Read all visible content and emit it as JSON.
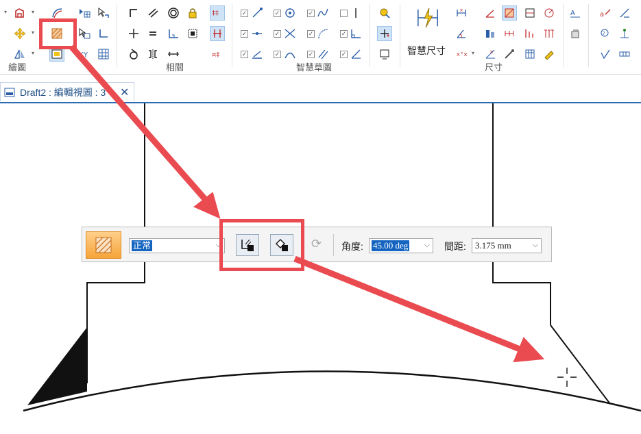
{
  "ribbon": {
    "groups": {
      "draw": "繪圖",
      "relate": "相關",
      "smart_sketch": "智慧草圖",
      "dimension": "尺寸"
    },
    "smart_dimension_label": "智慧尺寸",
    "icons": [
      "polygon-icon",
      "move-icon",
      "mirror-icon",
      "curve-icon",
      "fill-icon",
      "table-icon",
      "arrow-icon",
      "select-icon",
      "corner-icon",
      "line-icon",
      "circle-icon",
      "lock-icon",
      "symmetric-icon",
      "collinear-icon",
      "parallel-icon",
      "rigid-icon",
      "checkbox-icon",
      "smart-dimension-icon"
    ]
  },
  "document_tab": {
    "title": "Draft2 : 編輯視圖 : 3",
    "close_label": "✕"
  },
  "command_bar": {
    "fill_style_value": "正常",
    "angle_label": "角度:",
    "angle_value": "45.00 deg",
    "spacing_label": "間距:",
    "spacing_value": "3.175 mm"
  },
  "colors": {
    "accent_red": "#ea4b50",
    "tab_blue": "#2b6cb3",
    "selection_blue": "#1565c0",
    "fill_orange": "#f6a43a"
  }
}
